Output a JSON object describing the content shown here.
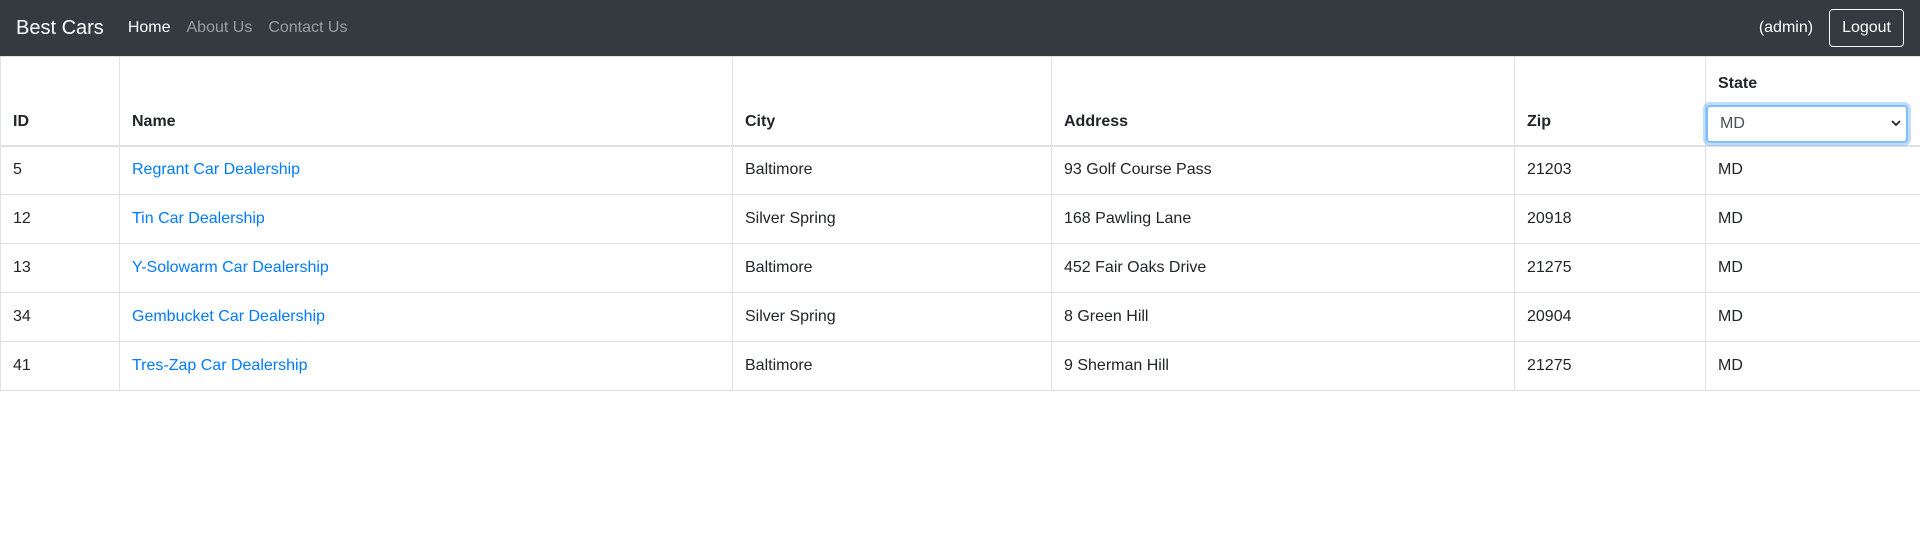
{
  "navbar": {
    "brand": "Best Cars",
    "links": [
      {
        "label": "Home",
        "active": true
      },
      {
        "label": "About Us",
        "active": false
      },
      {
        "label": "Contact Us",
        "active": false
      }
    ],
    "user_label": "(admin)",
    "logout_label": "Logout"
  },
  "table": {
    "headers": {
      "id": "ID",
      "name": "Name",
      "city": "City",
      "address": "Address",
      "zip": "Zip",
      "state": "State"
    },
    "state_filter": {
      "selected": "MD",
      "options": [
        "MD"
      ]
    },
    "rows": [
      {
        "id": "5",
        "name": "Regrant Car Dealership",
        "city": "Baltimore",
        "address": "93 Golf Course Pass",
        "zip": "21203",
        "state": "MD"
      },
      {
        "id": "12",
        "name": "Tin Car Dealership",
        "city": "Silver Spring",
        "address": "168 Pawling Lane",
        "zip": "20918",
        "state": "MD"
      },
      {
        "id": "13",
        "name": "Y-Solowarm Car Dealership",
        "city": "Baltimore",
        "address": "452 Fair Oaks Drive",
        "zip": "21275",
        "state": "MD"
      },
      {
        "id": "34",
        "name": "Gembucket Car Dealership",
        "city": "Silver Spring",
        "address": "8 Green Hill",
        "zip": "20904",
        "state": "MD"
      },
      {
        "id": "41",
        "name": "Tres-Zap Car Dealership",
        "city": "Baltimore",
        "address": "9 Sherman Hill",
        "zip": "21275",
        "state": "MD"
      }
    ]
  },
  "colors": {
    "navbar_bg": "#343a40",
    "link": "#007bff",
    "focus_border": "#80bdff"
  }
}
